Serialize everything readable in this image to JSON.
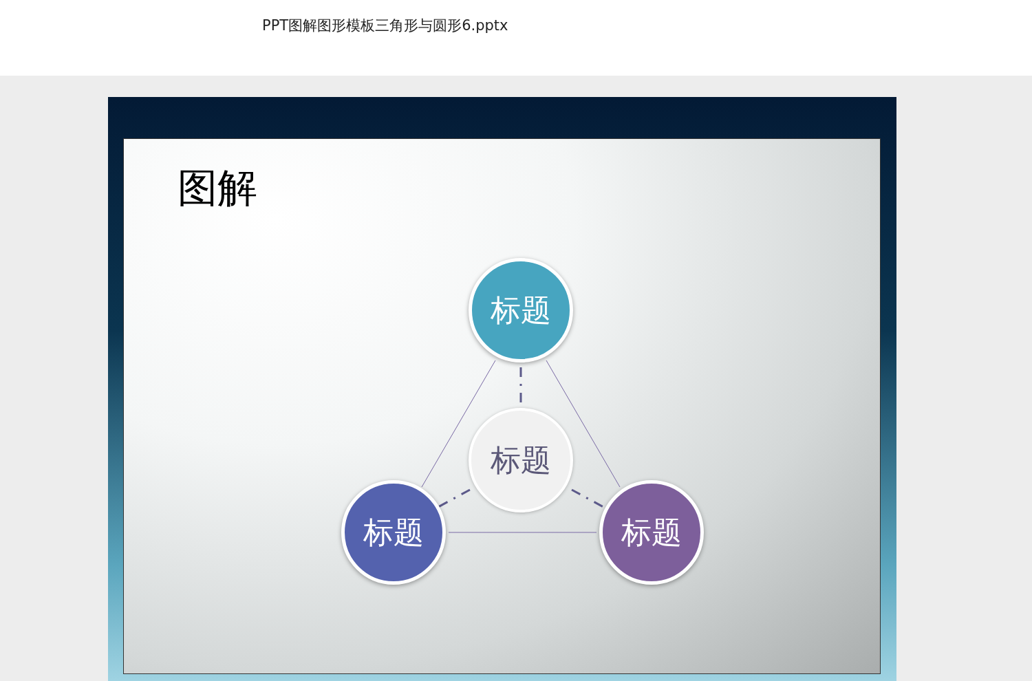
{
  "page": {
    "filename": "PPT图解图形模板三角形与圆形6.pptx"
  },
  "slide": {
    "title": "图解",
    "nodes": [
      {
        "label": "标题",
        "color": "#47a5c0"
      },
      {
        "label": "标题",
        "color": "#5462ae"
      },
      {
        "label": "标题",
        "color": "#7d5f9b"
      }
    ],
    "center": {
      "label": "标题"
    }
  }
}
